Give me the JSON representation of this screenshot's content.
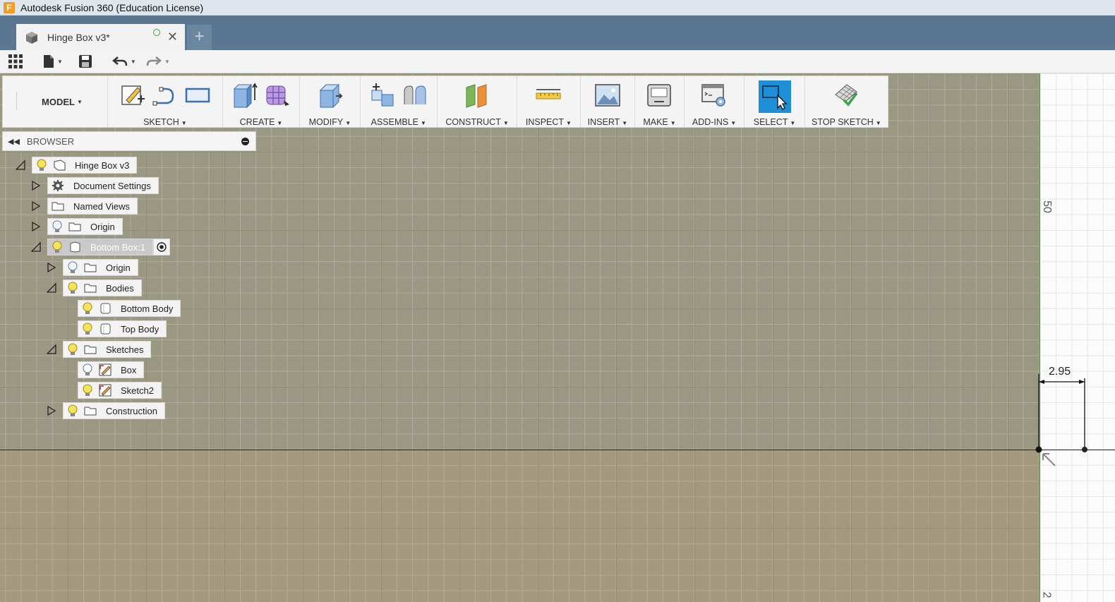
{
  "window": {
    "title": "Autodesk Fusion 360 (Education License)"
  },
  "tab": {
    "name": "Hinge Box v3*",
    "new_tab": "+"
  },
  "ribbon": {
    "workspace": "MODEL",
    "groups": [
      {
        "label": "SKETCH"
      },
      {
        "label": "CREATE"
      },
      {
        "label": "MODIFY"
      },
      {
        "label": "ASSEMBLE"
      },
      {
        "label": "CONSTRUCT"
      },
      {
        "label": "INSPECT"
      },
      {
        "label": "INSERT"
      },
      {
        "label": "MAKE"
      },
      {
        "label": "ADD-INS"
      },
      {
        "label": "SELECT"
      },
      {
        "label": "STOP SKETCH"
      }
    ]
  },
  "browser": {
    "title": "BROWSER",
    "items": [
      {
        "label": "Hinge Box v3"
      },
      {
        "label": "Document Settings"
      },
      {
        "label": "Named Views"
      },
      {
        "label": "Origin"
      },
      {
        "label": "Bottom Box:1"
      },
      {
        "label": "Origin"
      },
      {
        "label": "Bodies"
      },
      {
        "label": "Bottom Body"
      },
      {
        "label": "Top Body"
      },
      {
        "label": "Sketches"
      },
      {
        "label": "Box"
      },
      {
        "label": "Sketch2"
      },
      {
        "label": "Construction"
      }
    ]
  },
  "canvas": {
    "dimension": "2.95",
    "ruler_top": "50",
    "ruler_bottom": "2"
  },
  "colors": {
    "accent": "#1e8fd6",
    "tabbar": "#5a7690",
    "sketch_axis": "#6fa25a"
  }
}
